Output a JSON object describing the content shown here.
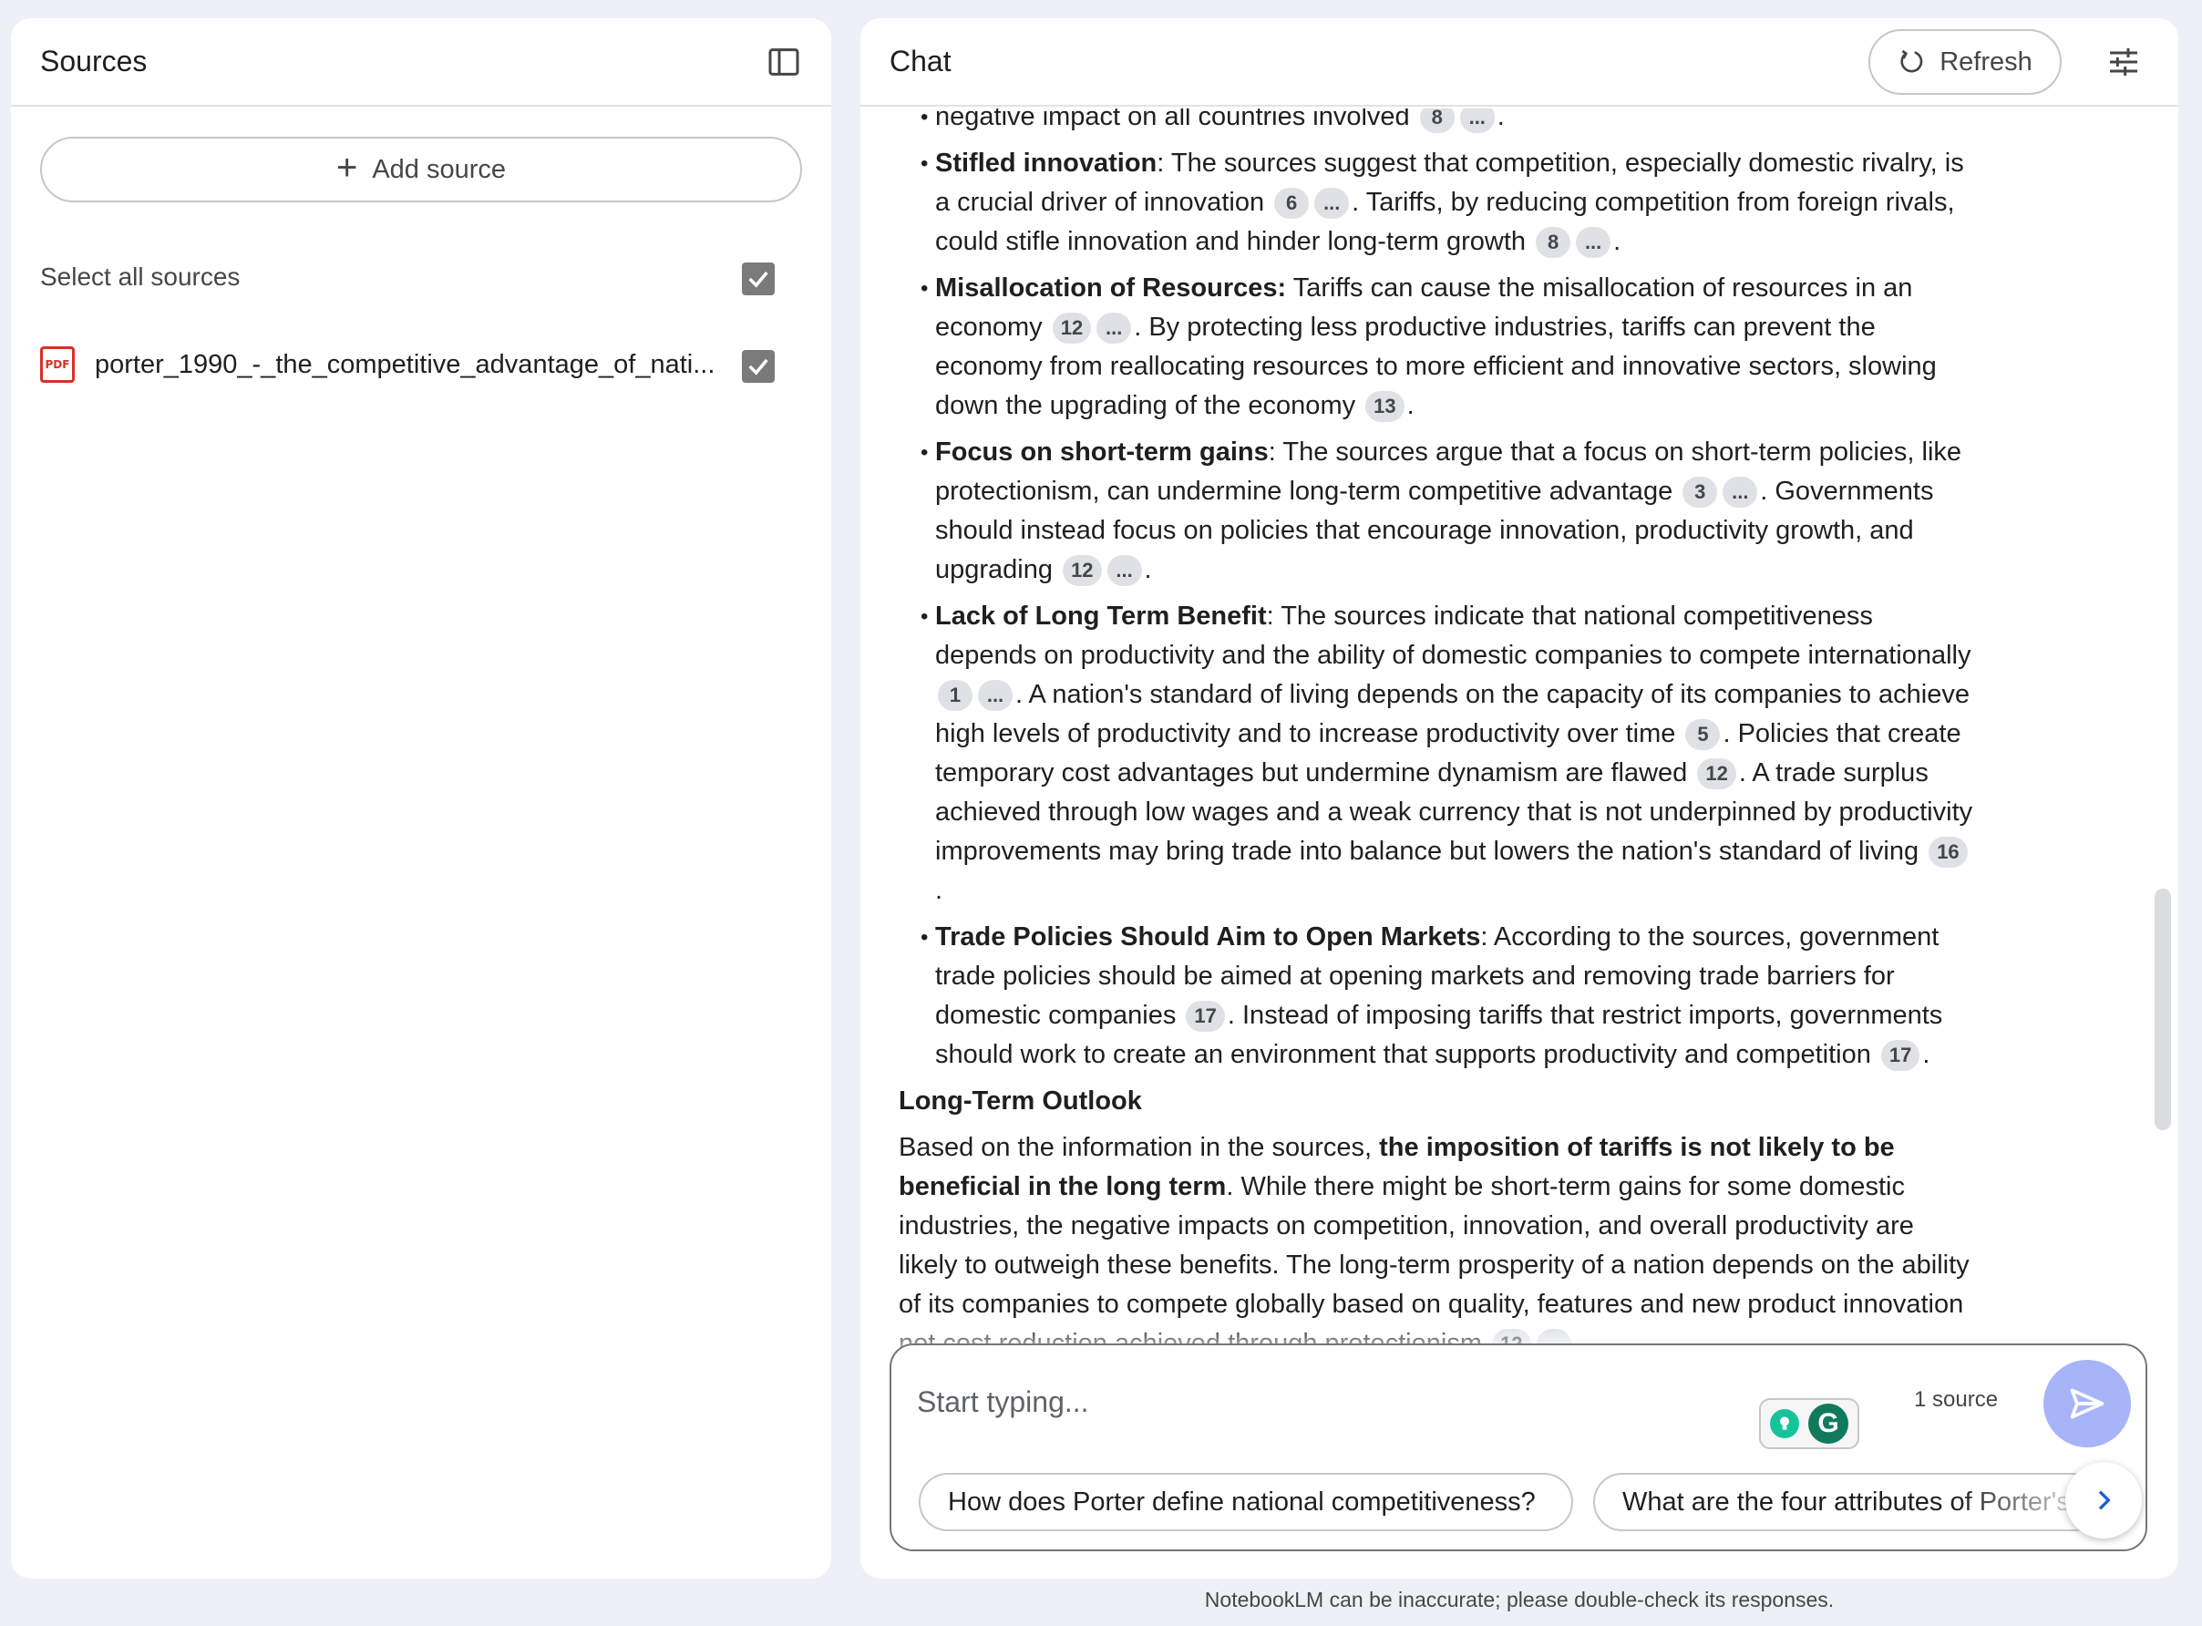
{
  "sources": {
    "title": "Sources",
    "add_source": "Add source",
    "select_all": "Select all sources",
    "items": [
      {
        "name": "porter_1990_-_the_competitive_advantage_of_nati..."
      }
    ]
  },
  "chat": {
    "title": "Chat",
    "refresh": "Refresh",
    "bullets": [
      {
        "parts": [
          {
            "t": "negative impact on all countries involved "
          },
          {
            "c": "8"
          },
          {
            "c": "..."
          },
          {
            "t": "."
          }
        ]
      },
      {
        "parts": [
          {
            "b": "Stifled innovation"
          },
          {
            "t": ": The sources suggest that competition, especially domestic rivalry, is a crucial driver of innovation "
          },
          {
            "c": "6"
          },
          {
            "c": "..."
          },
          {
            "t": ". Tariffs, by reducing competition from foreign rivals, could stifle innovation and hinder long-term growth "
          },
          {
            "c": "8"
          },
          {
            "c": "..."
          },
          {
            "t": "."
          }
        ]
      },
      {
        "parts": [
          {
            "b": "Misallocation of Resources:"
          },
          {
            "t": " Tariffs can cause the misallocation of resources in an economy "
          },
          {
            "c": "12"
          },
          {
            "c": "..."
          },
          {
            "t": ". By protecting less productive industries, tariffs can prevent the economy from reallocating resources to more efficient and innovative sectors, slowing down the upgrading of the economy "
          },
          {
            "c": "13"
          },
          {
            "t": "."
          }
        ]
      },
      {
        "parts": [
          {
            "b": "Focus on short-term gains"
          },
          {
            "t": ": The sources argue that a focus on short-term policies, like protectionism, can undermine long-term competitive advantage "
          },
          {
            "c": "3"
          },
          {
            "c": "..."
          },
          {
            "t": ". Governments should instead focus on policies that encourage innovation, productivity growth, and upgrading "
          },
          {
            "c": "12"
          },
          {
            "c": "..."
          },
          {
            "t": "."
          }
        ]
      },
      {
        "parts": [
          {
            "b": "Lack of Long Term Benefit"
          },
          {
            "t": ": The sources indicate that national competitiveness depends on productivity and the ability of domestic companies to compete internationally "
          },
          {
            "c": "1"
          },
          {
            "c": "..."
          },
          {
            "t": ". A nation's standard of living depends on the capacity of its companies to achieve high levels of productivity and to increase productivity over time "
          },
          {
            "c": "5"
          },
          {
            "t": ". Policies that create temporary cost advantages but undermine dynamism are flawed "
          },
          {
            "c": "12"
          },
          {
            "t": ". A trade surplus achieved through low wages and a weak currency that is not underpinned by productivity improvements may bring trade into balance but lowers the nation's standard of living "
          },
          {
            "c": "16"
          },
          {
            "t": "."
          }
        ]
      },
      {
        "parts": [
          {
            "b": "Trade Policies Should Aim to Open Markets"
          },
          {
            "t": ": According to the sources, government trade policies should be aimed at opening markets and removing trade barriers for domestic companies "
          },
          {
            "c": "17"
          },
          {
            "t": ". Instead of imposing tariffs that restrict imports, governments should work to create an environment that supports productivity and competition "
          },
          {
            "c": "17"
          },
          {
            "t": "."
          }
        ]
      }
    ],
    "outlook_heading": "Long-Term Outlook",
    "outlook": [
      {
        "t": "Based on the information in the sources, "
      },
      {
        "b": "the imposition of tariffs is not likely to be beneficial in the long term"
      },
      {
        "t": ". While there might be short-term gains for some domestic industries, the negative impacts on competition, innovation, and overall productivity are likely to outweigh these benefits. The long-term prosperity of a nation depends on the ability of its companies to compete globally based on quality, features and new product innovation not cost reduction achieved through protectionism "
      },
      {
        "c": "12"
      },
      {
        "c": "..."
      },
      {
        "t": "."
      }
    ],
    "input_placeholder": "Start typing...",
    "input_value": "",
    "source_count": "1 source",
    "suggestions": [
      "How does Porter define national competitiveness?",
      "What are the four attributes of Porter's Diamond?"
    ]
  },
  "footer": {
    "disclaimer": "NotebookLM can be inaccurate; please double-check its responses."
  },
  "colors": {
    "background": "#eef0f8",
    "send_button": "#a8b4f8",
    "pdf_icon": "#d93025",
    "grammarly": "#15c39a"
  }
}
